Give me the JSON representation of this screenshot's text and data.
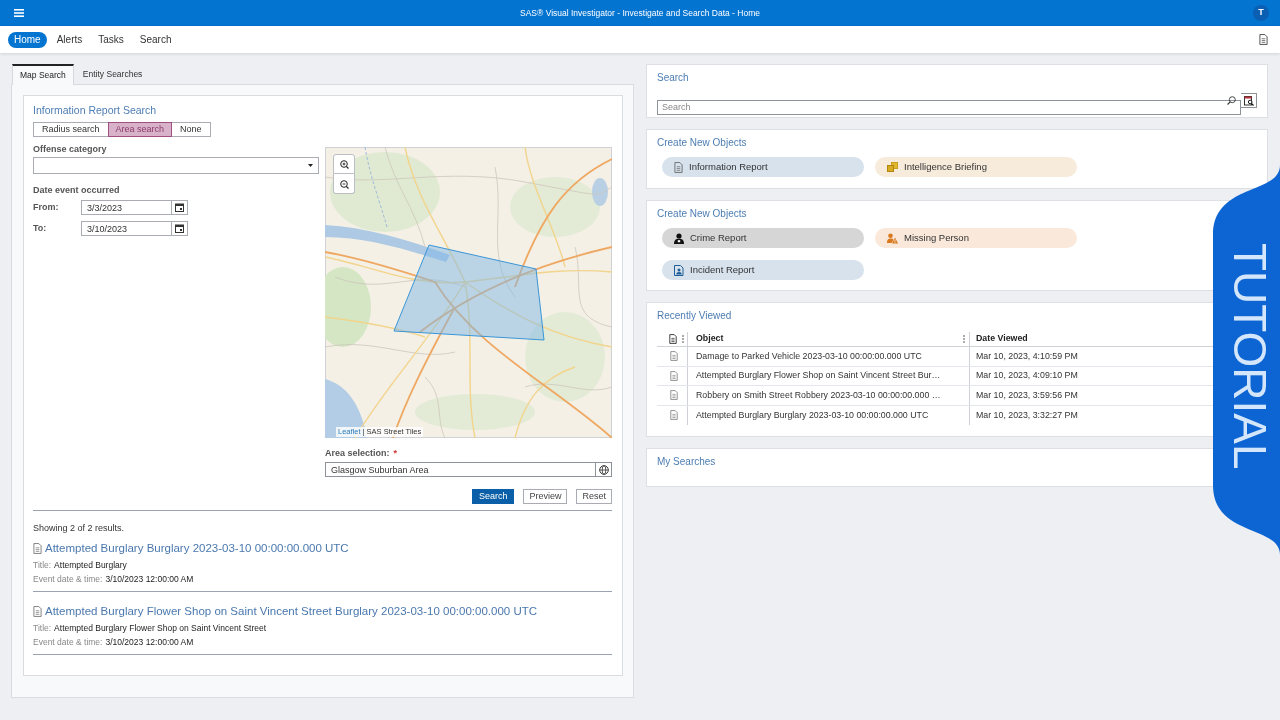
{
  "app_bar": {
    "title": "SAS® Visual Investigator - Investigate and Search Data - Home",
    "user_initial": "T"
  },
  "nav": {
    "items": [
      {
        "label": "Home",
        "selected": true
      },
      {
        "label": "Alerts",
        "selected": false
      },
      {
        "label": "Tasks",
        "selected": false
      },
      {
        "label": "Search",
        "selected": false
      }
    ]
  },
  "left_panel": {
    "tabs": [
      {
        "label": "Map Search",
        "selected": true
      },
      {
        "label": "Entity Searches",
        "selected": false
      }
    ],
    "form": {
      "title": "Information Report Search",
      "search_modes": [
        {
          "label": "Radius search",
          "selected": false
        },
        {
          "label": "Area search",
          "selected": true
        },
        {
          "label": "None",
          "selected": false
        }
      ],
      "offense_category": {
        "label": "Offense category"
      },
      "date_range": {
        "label": "Date event occurred",
        "fields": [
          {
            "label": "From:",
            "value": "3/3/2023"
          },
          {
            "label": "To:",
            "value": "3/10/2023"
          }
        ]
      },
      "map": {
        "attribution_link": "Leaflet",
        "attribution_text": "| SAS Street Tiles"
      },
      "area_selection": {
        "label": "Area selection:",
        "required_mark": "*",
        "value": "Glasgow Suburban Area"
      },
      "buttons": [
        {
          "label": "Search",
          "kind": "primary"
        },
        {
          "label": "Preview",
          "kind": "secondary"
        },
        {
          "label": "Reset",
          "kind": "secondary"
        }
      ]
    },
    "results": {
      "summary": "Showing 2 of 2 results.",
      "items": [
        {
          "title": "Attempted Burglary Burglary 2023-03-10 00:00:00.000 UTC",
          "fields": [
            {
              "label": "Title:",
              "value": "Attempted Burglary"
            },
            {
              "label": "Event date & time:",
              "value": "3/10/2023 12:00:00 AM"
            }
          ]
        },
        {
          "title": "Attempted Burglary Flower Shop on Saint Vincent Street Burglary 2023-03-10 00:00:00.000 UTC",
          "fields": [
            {
              "label": "Title:",
              "value": "Attempted Burglary Flower Shop on Saint Vincent Street"
            },
            {
              "label": "Event date & time:",
              "value": "3/10/2023 12:00:00 AM"
            }
          ]
        }
      ]
    }
  },
  "right_panel": {
    "search": {
      "title": "Search",
      "placeholder": "Search"
    },
    "create_groups": [
      {
        "title": "Create New Objects",
        "items": [
          {
            "label": "Information Report",
            "kind": "report",
            "color": "#d7e2ed"
          },
          {
            "label": "Intelligence Briefing",
            "kind": "briefing",
            "color": "#f7ebdb"
          }
        ]
      },
      {
        "title": "Create New Objects",
        "items": [
          {
            "label": "Crime Report",
            "kind": "crime",
            "color": "#d6d6d6"
          },
          {
            "label": "Missing Person",
            "kind": "missing",
            "color": "#fae8da"
          },
          {
            "label": "Incident Report",
            "kind": "incident",
            "color": "#d7e2ed"
          }
        ]
      }
    ],
    "recently_viewed": {
      "title": "Recently Viewed",
      "columns": [
        "Object",
        "Date Viewed"
      ],
      "rows": [
        {
          "object": "Damage to Parked Vehicle 2023-03-10 00:00:00.000 UTC",
          "date_viewed": "Mar 10, 2023, 4:10:59 PM"
        },
        {
          "object": "Attempted Burglary Flower Shop on Saint Vincent Street Bur…",
          "date_viewed": "Mar 10, 2023, 4:09:10 PM"
        },
        {
          "object": "Robbery on Smith Street Robbery 2023-03-10 00:00:00.000 …",
          "date_viewed": "Mar 10, 2023, 3:59:56 PM"
        },
        {
          "object": "Attempted Burglary Burglary 2023-03-10 00:00:00.000 UTC",
          "date_viewed": "Mar 10, 2023, 3:32:27 PM"
        }
      ]
    },
    "my_searches": {
      "title": "My Searches"
    }
  },
  "overlay": {
    "label": "TUTORIAL"
  }
}
